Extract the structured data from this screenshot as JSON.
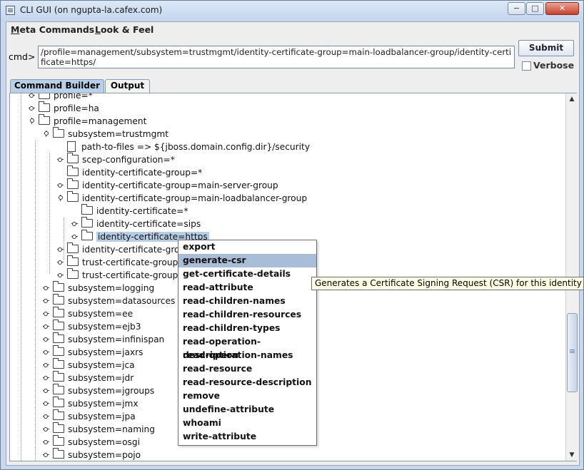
{
  "window": {
    "title": "CLI GUI (on ngupta-la.cafex.com)",
    "controls": {
      "minimize": "−",
      "maximize": "□",
      "close": "✕"
    }
  },
  "menubar": [
    {
      "mnemonic": "M",
      "rest": "eta Commands"
    },
    {
      "mnemonic": "L",
      "rest": "ook & Feel"
    }
  ],
  "command": {
    "label": "cmd>",
    "value": "/profile=management/subsystem=trustmgmt/identity-certificate-group=main-loadbalancer-group/identity-certificate=https/",
    "submit_label": "Submit",
    "verbose_label": "Verbose",
    "verbose_checked": false
  },
  "tabs": [
    {
      "label": "Command Builder",
      "active": true
    },
    {
      "label": "Output",
      "active": false
    }
  ],
  "tree": [
    {
      "label": "profile=*",
      "depth": 1,
      "state": "collapsed",
      "kind": "folder"
    },
    {
      "label": "profile=ha",
      "depth": 1,
      "state": "collapsed",
      "kind": "folder"
    },
    {
      "label": "profile=management",
      "depth": 1,
      "state": "expanded",
      "kind": "folder"
    },
    {
      "label": "subsystem=trustmgmt",
      "depth": 2,
      "state": "expanded",
      "kind": "folder"
    },
    {
      "label": "path-to-files => ${jboss.domain.config.dir}/security",
      "depth": 3,
      "state": "leaf",
      "kind": "file"
    },
    {
      "label": "scep-configuration=*",
      "depth": 3,
      "state": "collapsed",
      "kind": "folder"
    },
    {
      "label": "identity-certificate-group=*",
      "depth": 3,
      "state": "leaf",
      "kind": "folder"
    },
    {
      "label": "identity-certificate-group=main-server-group",
      "depth": 3,
      "state": "collapsed",
      "kind": "folder"
    },
    {
      "label": "identity-certificate-group=main-loadbalancer-group",
      "depth": 3,
      "state": "expanded",
      "kind": "folder"
    },
    {
      "label": "identity-certificate=*",
      "depth": 4,
      "state": "leaf",
      "kind": "folder"
    },
    {
      "label": "identity-certificate=sips",
      "depth": 4,
      "state": "collapsed",
      "kind": "folder"
    },
    {
      "label": "identity-certificate=https",
      "depth": 4,
      "state": "collapsed",
      "kind": "folder",
      "selected": true
    },
    {
      "label": "identity-certificate-group=",
      "depth": 3,
      "state": "collapsed",
      "kind": "folder"
    },
    {
      "label": "trust-certificate-group=*",
      "depth": 3,
      "state": "collapsed",
      "kind": "folder"
    },
    {
      "label": "trust-certificate-group=de",
      "depth": 3,
      "state": "collapsed",
      "kind": "folder"
    },
    {
      "label": "subsystem=logging",
      "depth": 2,
      "state": "collapsed",
      "kind": "folder"
    },
    {
      "label": "subsystem=datasources",
      "depth": 2,
      "state": "collapsed",
      "kind": "folder"
    },
    {
      "label": "subsystem=ee",
      "depth": 2,
      "state": "collapsed",
      "kind": "folder"
    },
    {
      "label": "subsystem=ejb3",
      "depth": 2,
      "state": "collapsed",
      "kind": "folder"
    },
    {
      "label": "subsystem=infinispan",
      "depth": 2,
      "state": "collapsed",
      "kind": "folder"
    },
    {
      "label": "subsystem=jaxrs",
      "depth": 2,
      "state": "collapsed",
      "kind": "folder"
    },
    {
      "label": "subsystem=jca",
      "depth": 2,
      "state": "collapsed",
      "kind": "folder"
    },
    {
      "label": "subsystem=jdr",
      "depth": 2,
      "state": "collapsed",
      "kind": "folder"
    },
    {
      "label": "subsystem=jgroups",
      "depth": 2,
      "state": "collapsed",
      "kind": "folder"
    },
    {
      "label": "subsystem=jmx",
      "depth": 2,
      "state": "collapsed",
      "kind": "folder"
    },
    {
      "label": "subsystem=jpa",
      "depth": 2,
      "state": "collapsed",
      "kind": "folder"
    },
    {
      "label": "subsystem=naming",
      "depth": 2,
      "state": "collapsed",
      "kind": "folder"
    },
    {
      "label": "subsystem=osgi",
      "depth": 2,
      "state": "collapsed",
      "kind": "folder"
    },
    {
      "label": "subsystem=pojo",
      "depth": 2,
      "state": "collapsed",
      "kind": "folder"
    }
  ],
  "context_menu": {
    "items": [
      {
        "label": "export"
      },
      {
        "label": "generate-csr",
        "highlighted": true
      },
      {
        "label": "get-certificate-details"
      },
      {
        "label": "read-attribute"
      },
      {
        "label": "read-children-names"
      },
      {
        "label": "read-children-resources"
      },
      {
        "label": "read-children-types"
      },
      {
        "label": "read-operation-description"
      },
      {
        "label": "read-operation-names"
      },
      {
        "label": "read-resource"
      },
      {
        "label": "read-resource-description"
      },
      {
        "label": "remove"
      },
      {
        "label": "undefine-attribute"
      },
      {
        "label": "whoami"
      },
      {
        "label": "write-attribute"
      }
    ]
  },
  "tooltip": {
    "text": "Generates a Certificate Signing Request (CSR) for this identity certi"
  },
  "colors": {
    "selection": "#b8cde6",
    "menu_highlight": "#a9bdd6",
    "tooltip_bg": "#ffffe6",
    "active_tab": "#b8cfe8"
  },
  "scrollbar": {
    "up_arrow": "▲",
    "down_arrow": "▼"
  }
}
